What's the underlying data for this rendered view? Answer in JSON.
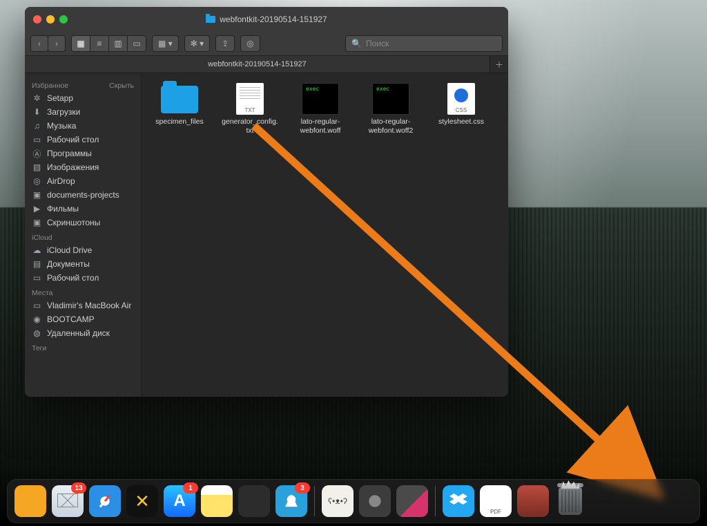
{
  "window": {
    "title": "webfontkit-20190514-151927",
    "tab_label": "webfontkit-20190514-151927",
    "search_placeholder": "Поиск"
  },
  "sidebar": {
    "favorites": {
      "header": "Избранное",
      "hide": "Скрыть",
      "items": [
        {
          "label": "Setapp",
          "icon": "setapp"
        },
        {
          "label": "Загрузки",
          "icon": "downloads"
        },
        {
          "label": "Музыка",
          "icon": "music"
        },
        {
          "label": "Рабочий стол",
          "icon": "desktop"
        },
        {
          "label": "Программы",
          "icon": "apps"
        },
        {
          "label": "Изображения",
          "icon": "pictures"
        },
        {
          "label": "AirDrop",
          "icon": "airdrop"
        },
        {
          "label": "documents-projects",
          "icon": "folder"
        },
        {
          "label": "Фильмы",
          "icon": "movies"
        },
        {
          "label": "Скриншотоны",
          "icon": "folder"
        }
      ]
    },
    "icloud": {
      "header": "iCloud",
      "items": [
        {
          "label": "iCloud Drive",
          "icon": "cloud"
        },
        {
          "label": "Документы",
          "icon": "documents"
        },
        {
          "label": "Рабочий стол",
          "icon": "desktop"
        }
      ]
    },
    "locations": {
      "header": "Места",
      "items": [
        {
          "label": "Vladimir's MacBook Air",
          "icon": "laptop"
        },
        {
          "label": "BOOTCAMP",
          "icon": "disk"
        },
        {
          "label": "Удаленный диск",
          "icon": "remote-disk"
        }
      ]
    },
    "tags": {
      "header": "Теги"
    }
  },
  "files": [
    {
      "name": "specimen_files",
      "type": "folder"
    },
    {
      "name": "generator_config.txt",
      "type": "txt"
    },
    {
      "name": "lato-regular-webfont.woff",
      "type": "exec"
    },
    {
      "name": "lato-regular-webfont.woff2",
      "type": "exec"
    },
    {
      "name": "stylesheet.css",
      "type": "css"
    }
  ],
  "dock": [
    {
      "name": "forklift",
      "badge": null
    },
    {
      "name": "mail",
      "badge": "13"
    },
    {
      "name": "safari",
      "badge": null
    },
    {
      "name": "butterfly",
      "badge": null
    },
    {
      "name": "appstore",
      "badge": "1"
    },
    {
      "name": "notes",
      "badge": null
    },
    {
      "name": "logic",
      "badge": null
    },
    {
      "name": "telegram",
      "badge": "3"
    }
  ],
  "dock_right": [
    {
      "name": "bear"
    },
    {
      "name": "settings"
    },
    {
      "name": "cleanmymac"
    }
  ],
  "dock_files": [
    {
      "name": "dropbox"
    },
    {
      "name": "pdf"
    },
    {
      "name": "stack"
    },
    {
      "name": "trash"
    }
  ],
  "annotation": {
    "arrow_color": "#ec7b1a"
  }
}
